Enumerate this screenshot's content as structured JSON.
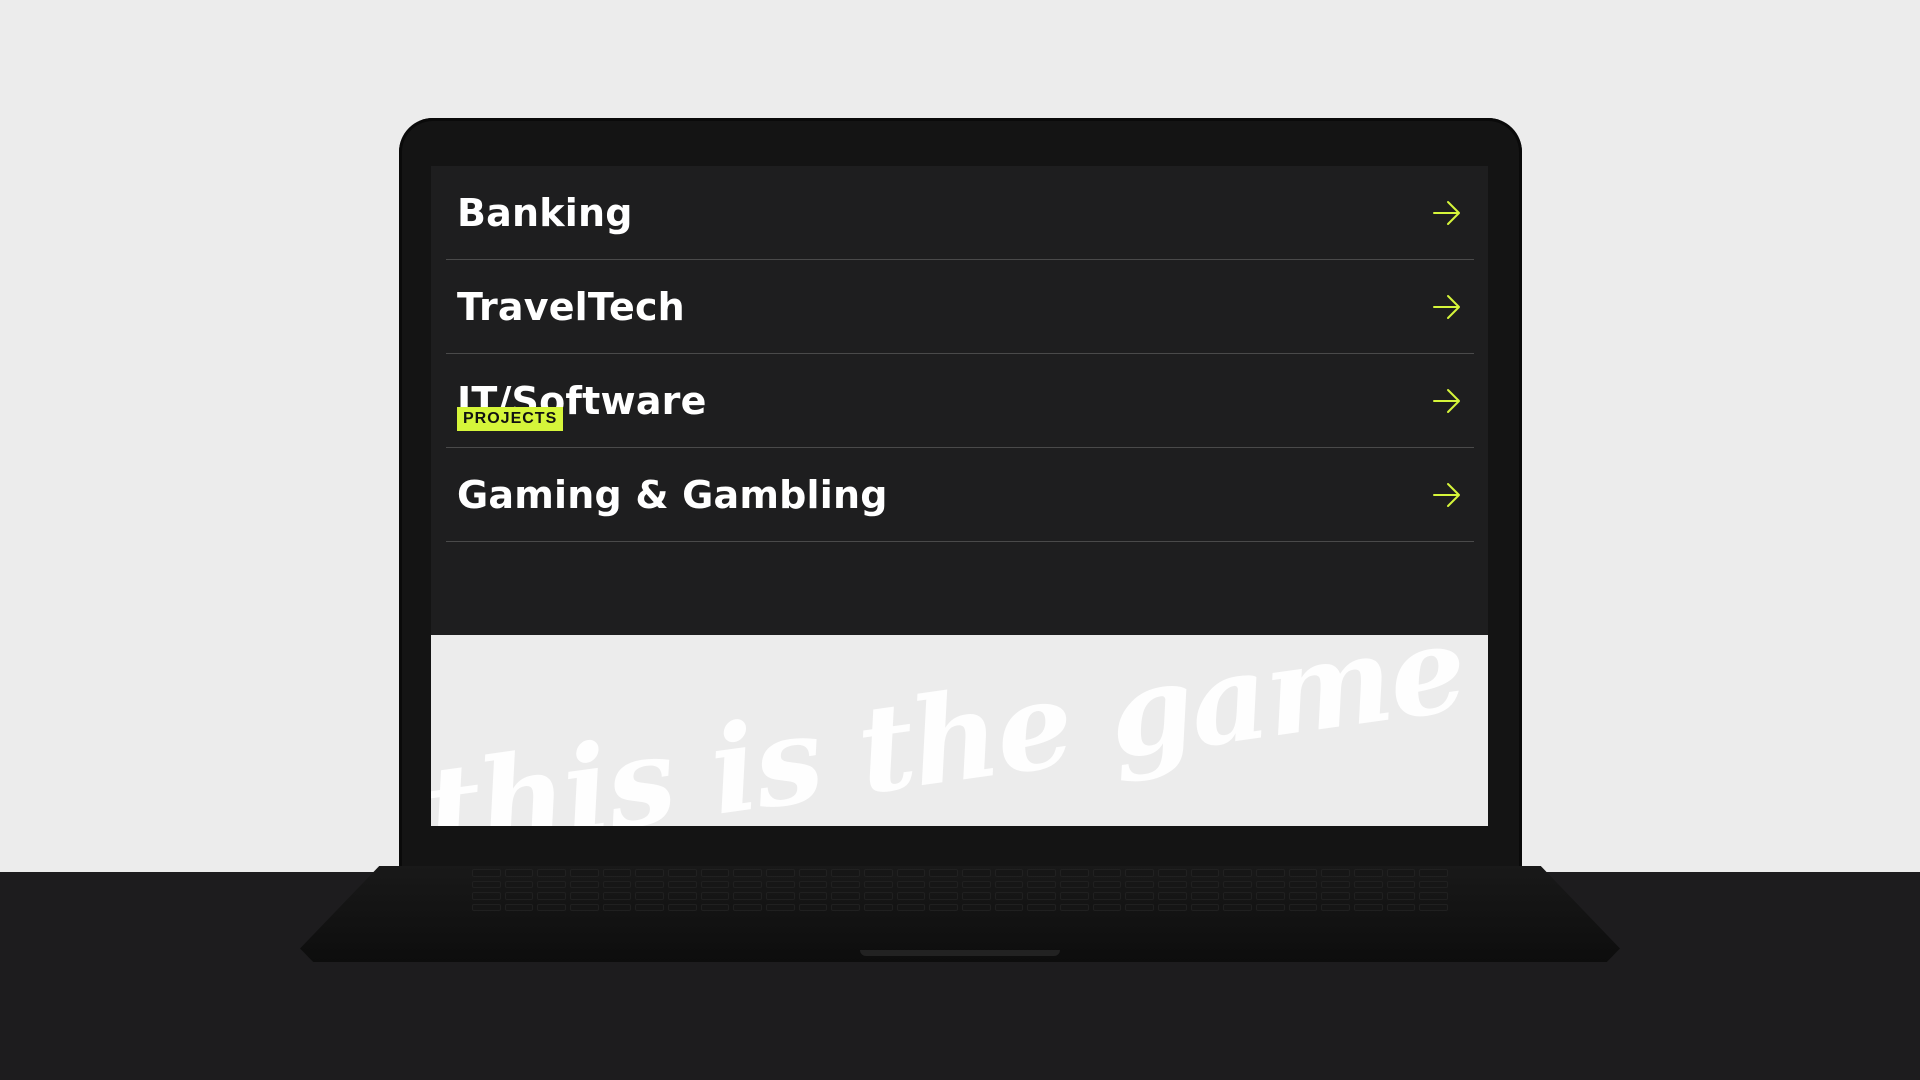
{
  "industries": [
    {
      "label": "Banking"
    },
    {
      "label": "TravelTech"
    },
    {
      "label": "IT/Software"
    },
    {
      "label": "Gaming & Gambling"
    }
  ],
  "projects": {
    "badge": "PROJECTS",
    "watermark": "this is the game we play"
  },
  "colors": {
    "accent": "#d5f53a",
    "screen_bg": "#1e1e1f",
    "section_bg": "#ececec",
    "divider": "#4a4a4a"
  },
  "icons": {
    "list_arrow": "arrow-right-icon"
  }
}
